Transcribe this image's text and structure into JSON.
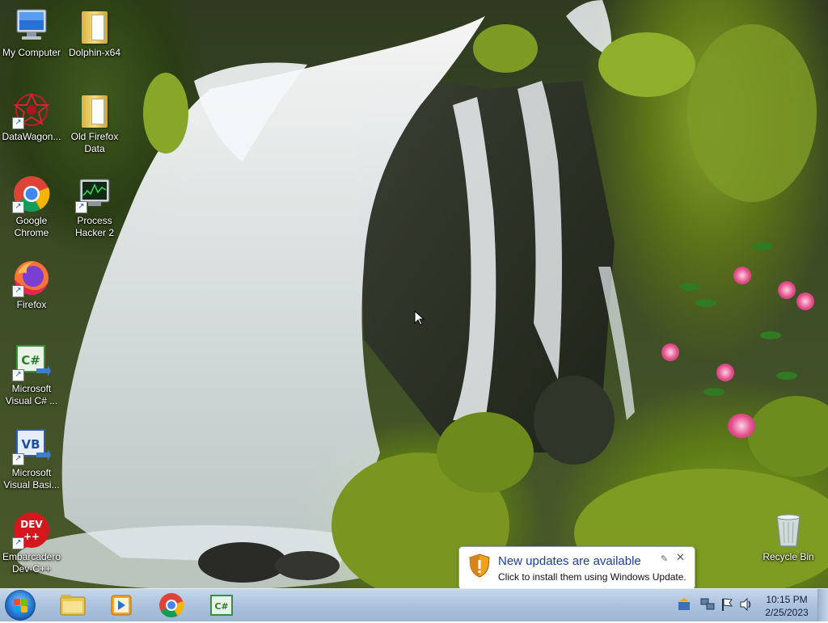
{
  "desktop": {
    "icons": [
      {
        "label": "My Computer",
        "icon": "computer-icon"
      },
      {
        "label": "Dolphin-x64",
        "icon": "folder-icon"
      },
      {
        "label": "DataWagon...",
        "icon": "datawagon-icon"
      },
      {
        "label": "Old Firefox Data",
        "icon": "folder-icon"
      },
      {
        "label": "Google Chrome",
        "icon": "chrome-icon"
      },
      {
        "label": "Process Hacker 2",
        "icon": "process-hacker-icon"
      },
      {
        "label": "Firefox",
        "icon": "firefox-icon"
      },
      {
        "label": "Microsoft Visual C# ...",
        "icon": "visual-csharp-icon"
      },
      {
        "label": "Microsoft Visual Basi...",
        "icon": "visual-basic-icon"
      },
      {
        "label": "Embarcadero Dev-C++",
        "icon": "devcpp-icon"
      },
      {
        "label": "Recycle Bin",
        "icon": "recycle-bin-icon"
      }
    ]
  },
  "notification": {
    "title": "New updates are available",
    "body": "Click to install them using Windows Update.",
    "icon": "shield-warning-icon"
  },
  "taskbar": {
    "start_icon": "windows-start-icon",
    "pinned": [
      "file-explorer-icon",
      "media-player-icon",
      "chrome-icon",
      "visual-csharp-icon"
    ],
    "tray": [
      "windows-update-icon",
      "network-icon",
      "action-center-flag-icon",
      "volume-icon"
    ],
    "clock": {
      "time": "10:15 PM",
      "date": "2/25/2023"
    }
  }
}
